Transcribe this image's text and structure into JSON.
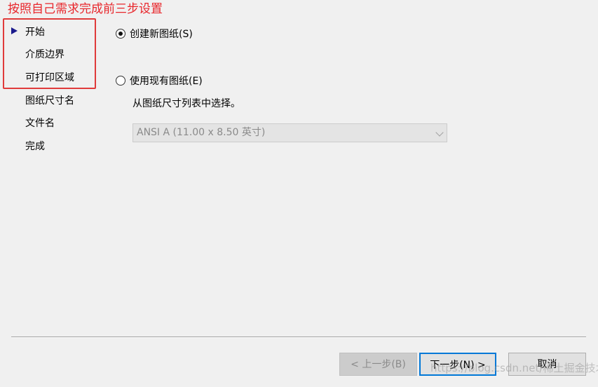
{
  "annotation": {
    "text": "按照自己需求完成前三步设置"
  },
  "sidebar": {
    "items": [
      {
        "label": "开始",
        "current": true
      },
      {
        "label": "介质边界"
      },
      {
        "label": "可打印区域"
      },
      {
        "label": "图纸尺寸名"
      },
      {
        "label": "文件名"
      },
      {
        "label": "完成"
      }
    ]
  },
  "main": {
    "option_new": {
      "label": "创建新图纸(S)",
      "checked": true
    },
    "option_existing": {
      "label": "使用现有图纸(E)",
      "checked": false
    },
    "hint": "从图纸尺寸列表中选择。",
    "paper_select": {
      "value": "ANSI A (11.00 x 8.50 英寸)",
      "disabled": true
    }
  },
  "footer": {
    "back_label": "< 上一步(B)",
    "next_label": "下一步(N) >",
    "cancel_label": "取消"
  },
  "watermark": "https://blog.csdn.net/稀土掘金技术社区"
}
